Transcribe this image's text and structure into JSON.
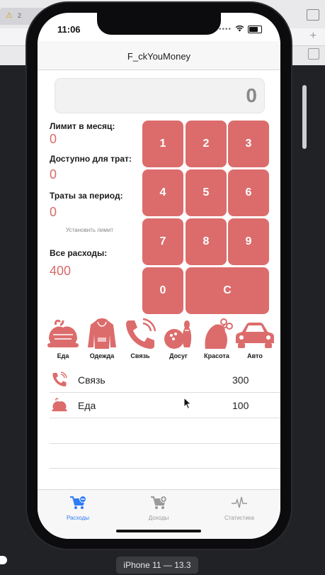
{
  "host": {
    "warning_count": "2",
    "device_label": "iPhone 11 — 13.3"
  },
  "status": {
    "time": "11:06"
  },
  "app": {
    "title": "F_ckYouMoney"
  },
  "display": {
    "value": "0"
  },
  "info": {
    "limit_label": "Лимит в месяц:",
    "limit_value": "0",
    "available_label": "Доступно для трат:",
    "available_value": "0",
    "period_label": "Траты за период:",
    "period_value": "0",
    "set_limit_link": "Установить лимит",
    "total_label": "Все расходы:",
    "total_value": "400"
  },
  "keypad": {
    "k1": "1",
    "k2": "2",
    "k3": "3",
    "k4": "4",
    "k5": "5",
    "k6": "6",
    "k7": "7",
    "k8": "8",
    "k9": "9",
    "k0": "0",
    "kc": "C"
  },
  "categories": {
    "food": "Еда",
    "clothes": "Одежда",
    "phone": "Связь",
    "leisure": "Досуг",
    "beauty": "Красота",
    "auto": "Авто"
  },
  "expenses": [
    {
      "name": "Связь",
      "amount": "300",
      "icon": "phone-icon"
    },
    {
      "name": "Еда",
      "amount": "100",
      "icon": "food-icon"
    }
  ],
  "tabs": {
    "expenses": "Расходы",
    "income": "Доходы",
    "stats": "Статистика"
  },
  "colors": {
    "accent": "#dc6c6c",
    "tab_active": "#2f7cf6",
    "tab_inactive": "#9a9a9a"
  }
}
